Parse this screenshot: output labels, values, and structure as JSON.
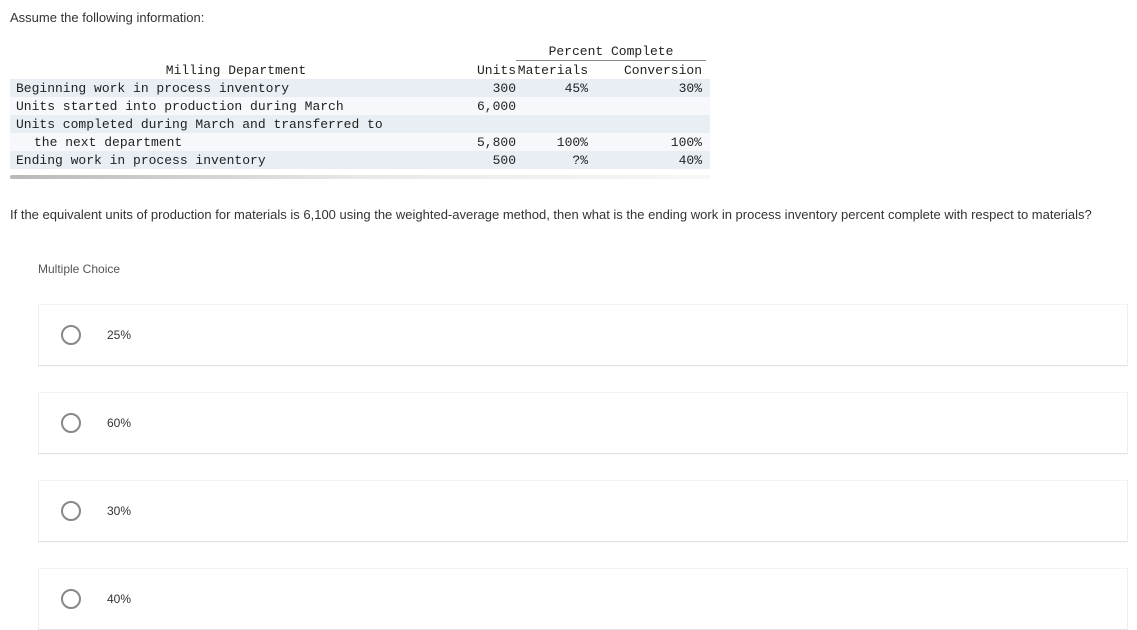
{
  "intro": "Assume the following information:",
  "table": {
    "percent_complete_header": "Percent Complete",
    "dept_header": "Milling Department",
    "col_units": "Units",
    "col_materials": "Materials",
    "col_conversion": "Conversion",
    "rows": [
      {
        "label": "Beginning work in process inventory",
        "units": "300",
        "materials": "45%",
        "conversion": "30%"
      },
      {
        "label": "Units started into production during March",
        "units": "6,000",
        "materials": "",
        "conversion": ""
      },
      {
        "label": "Units completed during March and transferred to",
        "units": "",
        "materials": "",
        "conversion": ""
      },
      {
        "label": "the next department",
        "units": "5,800",
        "materials": "100%",
        "conversion": "100%"
      },
      {
        "label": "Ending work in process inventory",
        "units": "500",
        "materials": "?%",
        "conversion": "40%"
      }
    ]
  },
  "question_text": "If the equivalent units of production for materials is 6,100 using the weighted-average method, then what is the ending work in process inventory percent complete with respect to materials?",
  "mc_label": "Multiple Choice",
  "options": [
    "25%",
    "60%",
    "30%",
    "40%"
  ]
}
